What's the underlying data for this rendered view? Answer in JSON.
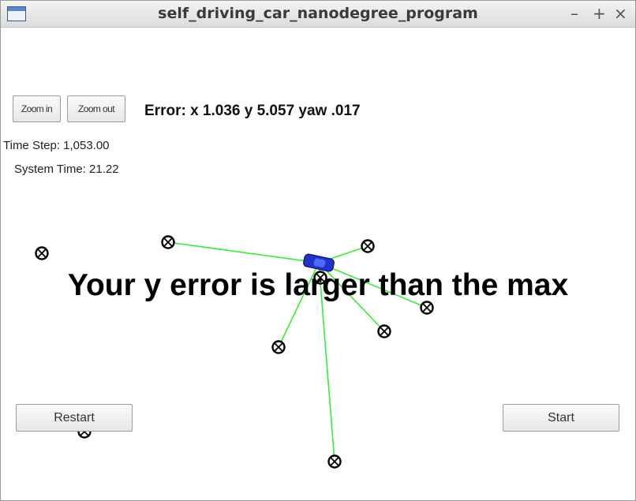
{
  "window": {
    "title": "self_driving_car_nanodegree_program",
    "controls": [
      "–",
      "+",
      "×"
    ]
  },
  "toolbar": {
    "zoom_in": "Zoom in",
    "zoom_out": "Zoom out"
  },
  "status": {
    "error_text": "Error: x 1.036 y 5.057 yaw .017",
    "time_step": "Time Step: 1,053.00",
    "system_time": "System Time: 21.22"
  },
  "message": "Your y error is larger than the max",
  "buttons": {
    "restart": "Restart",
    "start": "Start"
  },
  "colors": {
    "observation_line": "#33ee33",
    "vehicle": "#2233cc",
    "landmark": "#000000"
  }
}
